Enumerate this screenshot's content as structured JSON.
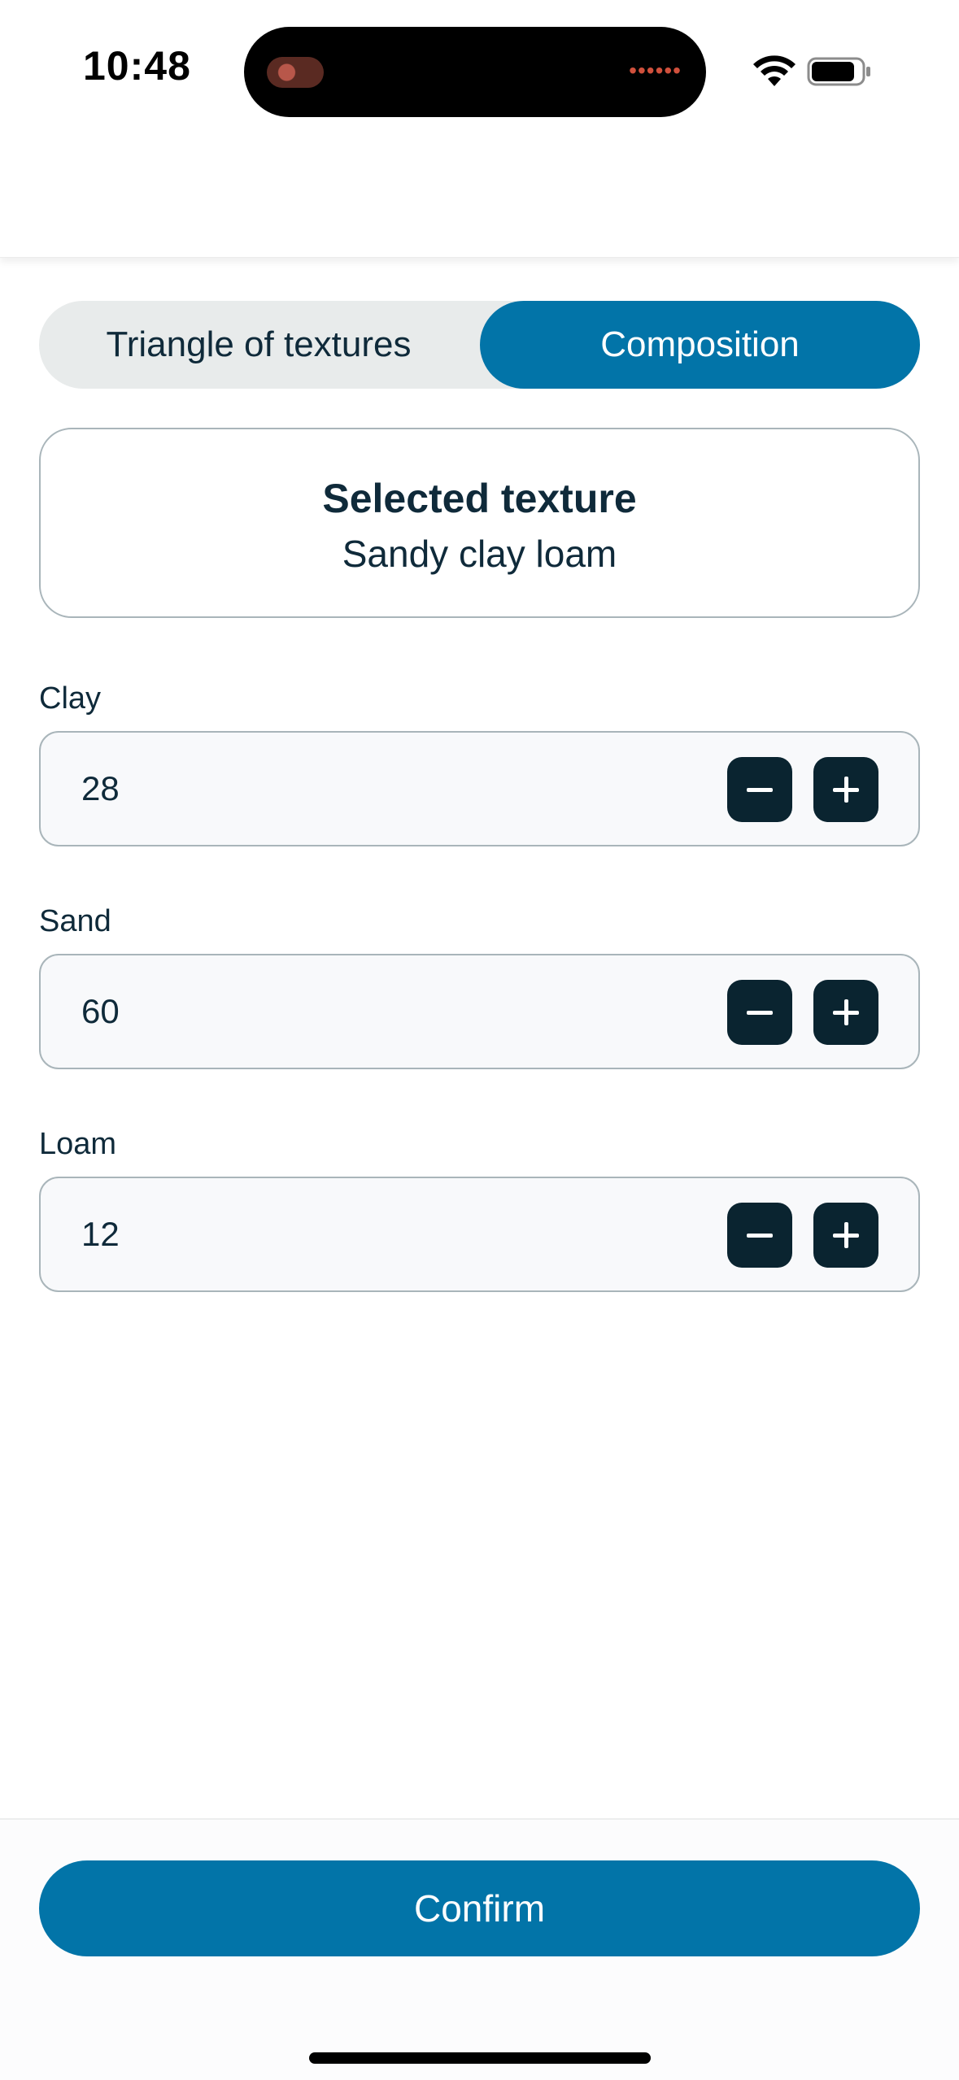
{
  "status_bar": {
    "time": "10:48",
    "icons": [
      "wifi-icon",
      "battery-icon"
    ]
  },
  "tabs": {
    "left_label": "Triangle of textures",
    "right_label": "Composition",
    "active": "Composition"
  },
  "selected_texture": {
    "title": "Selected texture",
    "value": "Sandy clay loam"
  },
  "fields": [
    {
      "label": "Clay",
      "value": "28"
    },
    {
      "label": "Sand",
      "value": "60"
    },
    {
      "label": "Loam",
      "value": "12"
    }
  ],
  "stepper_icons": [
    "minus-icon",
    "plus-icon"
  ],
  "footer": {
    "confirm_label": "Confirm"
  },
  "colors": {
    "accent": "#0274a8",
    "stepper": "#0a2430",
    "text": "#0f2a3a",
    "border": "#a9b5ba"
  }
}
